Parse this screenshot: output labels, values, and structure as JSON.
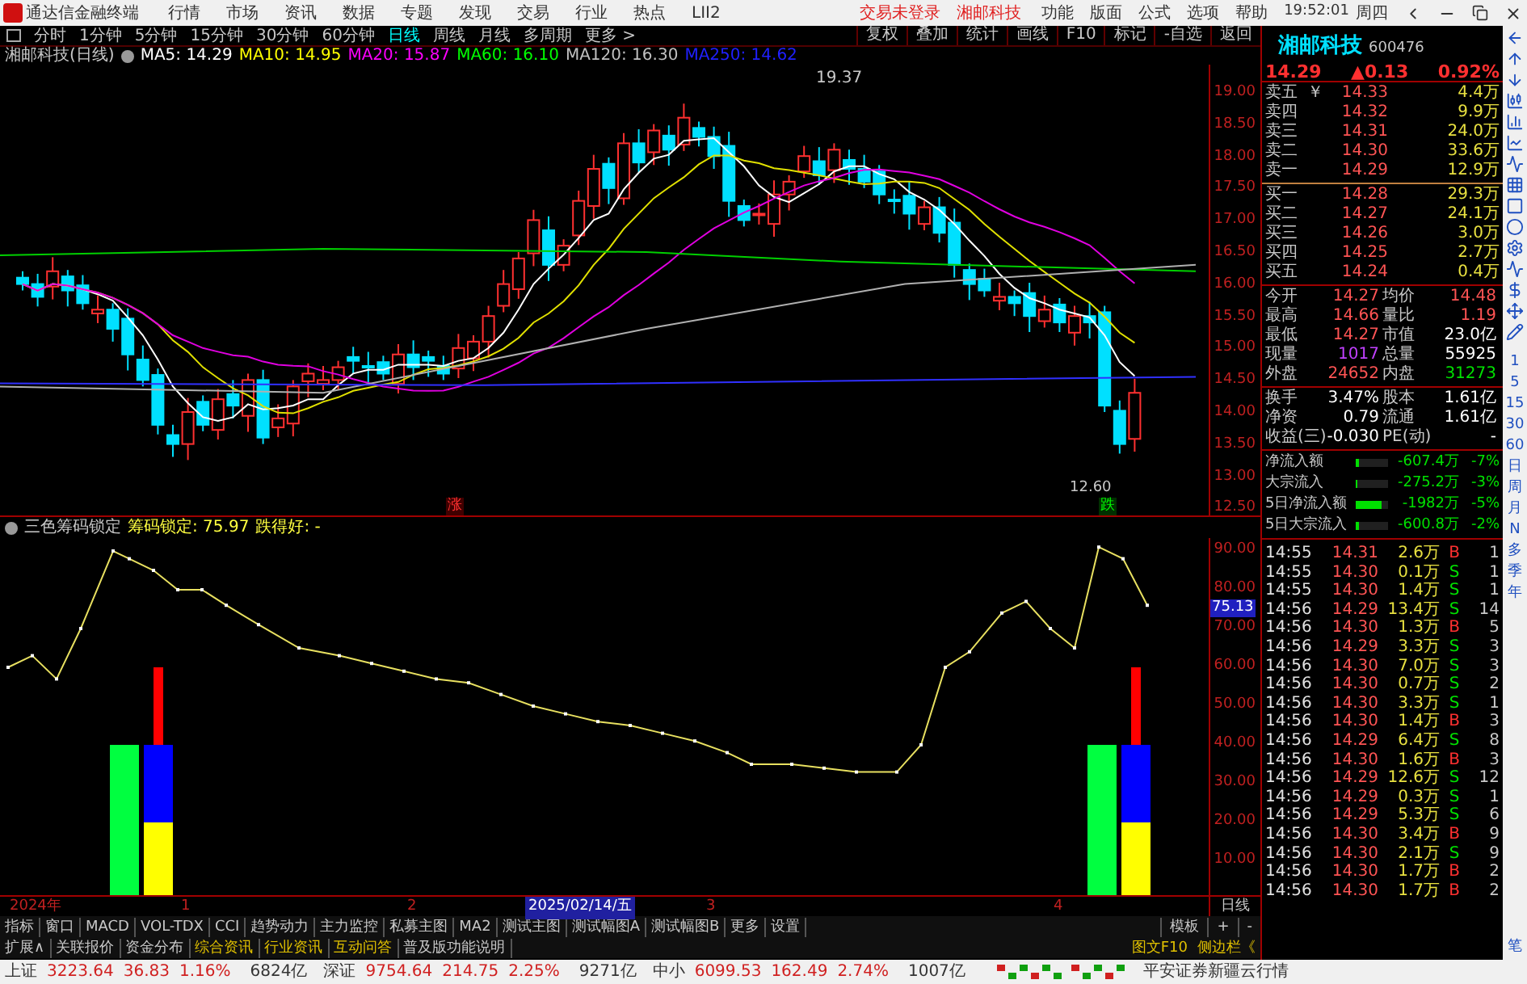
{
  "titlebar": {
    "app_title": "通达信金融终端",
    "menu": [
      "行情",
      "市场",
      "资讯",
      "数据",
      "专题",
      "发现",
      "交易",
      "行业",
      "热点",
      "LII2"
    ],
    "login_status": "交易未登录",
    "stock": "湘邮科技",
    "right_menu": [
      "功能",
      "版面",
      "公式",
      "选项",
      "帮助"
    ],
    "clock": "19:52:01",
    "weekday": "周四"
  },
  "period_tabs": [
    {
      "label": "分时",
      "selected": false
    },
    {
      "label": "1分钟",
      "selected": false
    },
    {
      "label": "5分钟",
      "selected": false
    },
    {
      "label": "15分钟",
      "selected": false
    },
    {
      "label": "30分钟",
      "selected": false
    },
    {
      "label": "60分钟",
      "selected": false
    },
    {
      "label": "日线",
      "selected": true
    },
    {
      "label": "周线",
      "selected": false
    },
    {
      "label": "月线",
      "selected": false
    },
    {
      "label": "多周期",
      "selected": false
    },
    {
      "label": "更多 >",
      "selected": false
    }
  ],
  "toolbar_buttons": [
    "复权",
    "叠加",
    "统计",
    "画线",
    "F10",
    "标记",
    "-自选",
    "返回"
  ],
  "chart": {
    "title": "湘邮科技(日线)",
    "ma_legend": [
      {
        "label": "MA5: 14.29",
        "color": "#ffffff"
      },
      {
        "label": "MA10: 14.95",
        "color": "#ffff00"
      },
      {
        "label": "MA20: 15.87",
        "color": "#ff00ff"
      },
      {
        "label": "MA60: 16.10",
        "color": "#00ff00"
      },
      {
        "label": "MA120: 16.30",
        "color": "#c0c0c0"
      },
      {
        "label": "MA250: 14.62",
        "color": "#2020ff"
      }
    ],
    "high_label": "19.37",
    "low_label": "12.60",
    "signals": [
      {
        "label": "涨",
        "kind": "up"
      },
      {
        "label": "跌",
        "kind": "down"
      }
    ],
    "yticks": [
      "19.00",
      "18.50",
      "18.00",
      "17.50",
      "17.00",
      "16.50",
      "16.00",
      "15.50",
      "15.00",
      "14.50",
      "14.00",
      "13.50",
      "13.00",
      "12.50"
    ]
  },
  "indicator": {
    "name": "三色筹码锁定",
    "value": "筹码锁定: 75.97",
    "extra": "跌得好: -",
    "yticks": [
      "90.00",
      "80.00",
      "70.00",
      "60.00",
      "50.00",
      "40.00",
      "30.00",
      "20.00",
      "10.00"
    ],
    "current": "75.13"
  },
  "timeline": {
    "labels": [
      {
        "label": "2024年",
        "selected": false
      },
      {
        "label": "1",
        "selected": false
      },
      {
        "label": "2",
        "selected": false
      },
      {
        "label": "2025/02/14/五",
        "selected": true
      },
      {
        "label": "3",
        "selected": false
      },
      {
        "label": "4",
        "selected": false
      }
    ],
    "period": "日线"
  },
  "indicator_tabs": [
    "指标",
    "窗口",
    "MACD",
    "VOL-TDX",
    "CCI",
    "趋势动力",
    "主力监控",
    "私募主图",
    "MA2",
    "测试主图",
    "测试幅图A",
    "测试幅图B",
    "更多",
    "设置"
  ],
  "template_buttons": [
    "模板",
    "+",
    "-"
  ],
  "info_tabs": [
    {
      "label": "扩展∧",
      "kind": "plain"
    },
    {
      "label": "关联报价",
      "kind": "plain"
    },
    {
      "label": "资金分布",
      "kind": "plain"
    },
    {
      "label": "综合资讯",
      "kind": "highlight"
    },
    {
      "label": "行业资讯",
      "kind": "highlight"
    },
    {
      "label": "互动问答",
      "kind": "highlight"
    },
    {
      "label": "普及版功能说明",
      "kind": "plain"
    }
  ],
  "info_right": [
    "图文F10",
    "侧边栏《"
  ],
  "quote": {
    "name": "湘邮科技",
    "code": "600476",
    "price": "14.29",
    "change": "▲0.13",
    "pct": "0.92%",
    "asks": [
      {
        "label": "卖五",
        "price": "14.33",
        "volume": "4.4万"
      },
      {
        "label": "卖四",
        "price": "14.32",
        "volume": "9.9万"
      },
      {
        "label": "卖三",
        "price": "14.31",
        "volume": "24.0万"
      },
      {
        "label": "卖二",
        "price": "14.30",
        "volume": "33.6万"
      },
      {
        "label": "卖一",
        "price": "14.29",
        "volume": "12.9万"
      }
    ],
    "ask_mark": "￥",
    "bids": [
      {
        "label": "买一",
        "price": "14.28",
        "volume": "29.3万"
      },
      {
        "label": "买二",
        "price": "14.27",
        "volume": "24.1万"
      },
      {
        "label": "买三",
        "price": "14.26",
        "volume": "3.0万"
      },
      {
        "label": "买四",
        "price": "14.25",
        "volume": "2.7万"
      },
      {
        "label": "买五",
        "price": "14.24",
        "volume": "0.4万"
      }
    ],
    "stats": [
      [
        {
          "label": "今开",
          "value": "14.27",
          "color": "#ff5454"
        },
        {
          "label": "均价",
          "value": "14.48",
          "color": "#ff5454"
        }
      ],
      [
        {
          "label": "最高",
          "value": "14.66",
          "color": "#ff5454"
        },
        {
          "label": "量比",
          "value": "1.19",
          "color": "#ff5454"
        }
      ],
      [
        {
          "label": "最低",
          "value": "14.27",
          "color": "#ff5454"
        },
        {
          "label": "市值",
          "value": "23.0亿",
          "color": "#ffffff"
        }
      ],
      [
        {
          "label": "现量",
          "value": "1017",
          "color": "#c040ff"
        },
        {
          "label": "总量",
          "value": "55925",
          "color": "#ffffff"
        }
      ],
      [
        {
          "label": "外盘",
          "value": "24652",
          "color": "#ff5454"
        },
        {
          "label": "内盘",
          "value": "31273",
          "color": "#00e000"
        }
      ]
    ],
    "fundamentals": [
      [
        {
          "label": "换手",
          "value": "3.47%"
        },
        {
          "label": "股本",
          "value": "1.61亿"
        }
      ],
      [
        {
          "label": "净资",
          "value": "0.79"
        },
        {
          "label": "流通",
          "value": "1.61亿"
        }
      ],
      [
        {
          "label": "收益(三)",
          "value": "-0.030"
        },
        {
          "label": "PE(动)",
          "value": "-"
        }
      ]
    ],
    "flows": [
      {
        "label": "净流入额",
        "value": "-607.4万",
        "pct": "-7%",
        "level": 0.12
      },
      {
        "label": "大宗流入",
        "value": "-275.2万",
        "pct": "-3%",
        "level": 0.05
      },
      {
        "label": "5日净流入额",
        "value": "-1982万",
        "pct": "-5%",
        "level": 0.8
      },
      {
        "label": "5日大宗流入",
        "value": "-600.8万",
        "pct": "-2%",
        "level": 0.12
      }
    ],
    "ticks": [
      {
        "time": "14:55",
        "price": "14.31",
        "volume": "2.6万",
        "side": "B",
        "kind": "buy",
        "count": "1"
      },
      {
        "time": "14:55",
        "price": "14.30",
        "volume": "0.1万",
        "side": "S",
        "kind": "sell",
        "count": "1"
      },
      {
        "time": "14:55",
        "price": "14.30",
        "volume": "1.4万",
        "side": "S",
        "kind": "sell",
        "count": "1"
      },
      {
        "time": "14:56",
        "price": "14.29",
        "volume": "13.4万",
        "side": "S",
        "kind": "sell",
        "count": "14"
      },
      {
        "time": "14:56",
        "price": "14.30",
        "volume": "1.3万",
        "side": "B",
        "kind": "buy",
        "count": "5"
      },
      {
        "time": "14:56",
        "price": "14.29",
        "volume": "3.3万",
        "side": "S",
        "kind": "sell",
        "count": "3"
      },
      {
        "time": "14:56",
        "price": "14.30",
        "volume": "7.0万",
        "side": "S",
        "kind": "sell",
        "count": "3"
      },
      {
        "time": "14:56",
        "price": "14.30",
        "volume": "0.7万",
        "side": "S",
        "kind": "sell",
        "count": "2"
      },
      {
        "time": "14:56",
        "price": "14.30",
        "volume": "3.3万",
        "side": "S",
        "kind": "sell",
        "count": "1"
      },
      {
        "time": "14:56",
        "price": "14.30",
        "volume": "1.4万",
        "side": "B",
        "kind": "buy",
        "count": "3"
      },
      {
        "time": "14:56",
        "price": "14.29",
        "volume": "6.4万",
        "side": "S",
        "kind": "sell",
        "count": "8"
      },
      {
        "time": "14:56",
        "price": "14.30",
        "volume": "1.6万",
        "side": "B",
        "kind": "buy",
        "count": "3"
      },
      {
        "time": "14:56",
        "price": "14.29",
        "volume": "12.6万",
        "side": "S",
        "kind": "sell",
        "count": "12"
      },
      {
        "time": "14:56",
        "price": "14.29",
        "volume": "0.3万",
        "side": "S",
        "kind": "sell",
        "count": "1"
      },
      {
        "time": "14:56",
        "price": "14.29",
        "volume": "5.3万",
        "side": "S",
        "kind": "sell",
        "count": "6"
      },
      {
        "time": "14:56",
        "price": "14.30",
        "volume": "3.4万",
        "side": "B",
        "kind": "buy",
        "count": "9"
      },
      {
        "time": "14:56",
        "price": "14.30",
        "volume": "2.1万",
        "side": "S",
        "kind": "sell",
        "count": "9"
      },
      {
        "time": "14:56",
        "price": "14.30",
        "volume": "1.7万",
        "side": "B",
        "kind": "buy",
        "count": "2"
      },
      {
        "time": "14:56",
        "price": "14.30",
        "volume": "1.7万",
        "side": "B",
        "kind": "buy",
        "count": "2"
      }
    ]
  },
  "side_periods": [
    "1",
    "5",
    "15",
    "30",
    "60",
    "日",
    "周",
    "月",
    "N",
    "多",
    "季",
    "年"
  ],
  "side_pen": "笔",
  "status_bar": {
    "indices": [
      {
        "name": "上证",
        "price": "3223.64",
        "change": "36.83",
        "pct": "1.16%",
        "amount": "6824亿"
      },
      {
        "name": "深证",
        "price": "9754.64",
        "change": "214.75",
        "pct": "2.25%",
        "amount": "9271亿"
      },
      {
        "name": "中小",
        "price": "6099.53",
        "change": "162.49",
        "pct": "2.74%",
        "amount": "1007亿"
      }
    ],
    "source": "平安证券新疆云行情"
  }
}
